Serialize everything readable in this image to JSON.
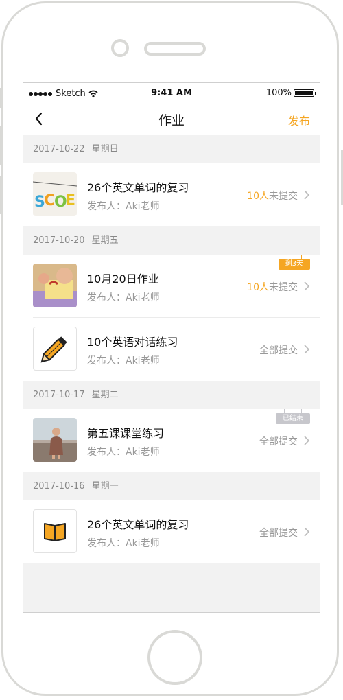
{
  "status_bar": {
    "carrier": "Sketch",
    "time": "9:41 AM",
    "battery": "100%"
  },
  "nav": {
    "title": "作业",
    "action": "发布",
    "back_icon": "chevron-left-icon"
  },
  "colors": {
    "accent": "#f5a623",
    "background": "#f2f2f2",
    "muted": "#999999"
  },
  "groups": [
    {
      "date": "2017-10-22",
      "weekday": "星期日",
      "items": [
        {
          "title": "26个英文单词的复习",
          "publisher": "发布人：Aki老师",
          "count": "10人",
          "status": "未提交",
          "thumb": "letters-photo"
        }
      ]
    },
    {
      "date": "2017-10-20",
      "weekday": "星期五",
      "items": [
        {
          "title": "10月20日作业",
          "publisher": "发布人：Aki老师",
          "count": "10人",
          "status": "未提交",
          "tag": "剩3天",
          "thumb": "craft-photo"
        },
        {
          "title": "10个英语对话练习",
          "publisher": "发布人：Aki老师",
          "count": "",
          "status": "全部提交",
          "thumb": "pencil-icon"
        }
      ]
    },
    {
      "date": "2017-10-17",
      "weekday": "星期二",
      "items": [
        {
          "title": "第五课课堂练习",
          "publisher": "发布人：Aki老师",
          "count": "",
          "status": "全部提交",
          "tag": "已结束",
          "thumb": "child-beach-photo"
        }
      ]
    },
    {
      "date": "2017-10-16",
      "weekday": "星期一",
      "items": [
        {
          "title": "26个英文单词的复习",
          "publisher": "发布人：Aki老师",
          "count": "",
          "status": "全部提交",
          "thumb": "book-icon"
        }
      ]
    }
  ]
}
